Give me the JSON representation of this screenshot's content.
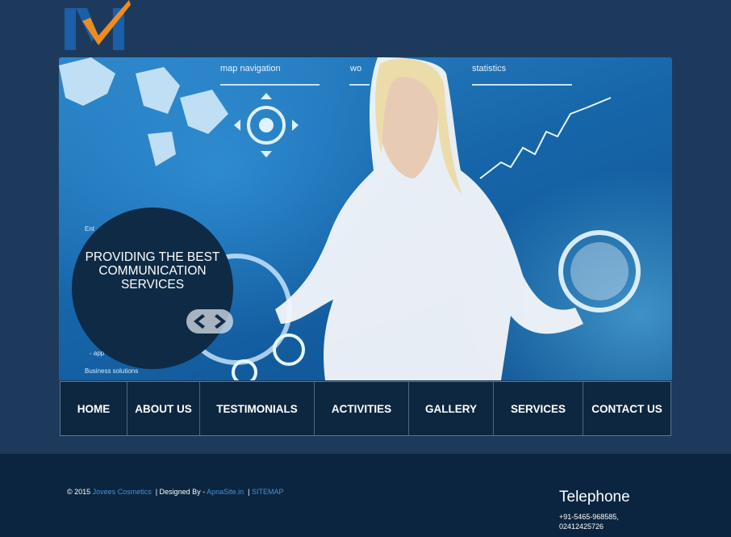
{
  "brand": {
    "logo_icon": "m-checkmark-logo-icon",
    "colors": {
      "blue": "#1a5fa8",
      "orange": "#f08c1e"
    }
  },
  "banner": {
    "hud_labels": {
      "map_navigation": "map navigation",
      "statistics": "statistics",
      "wo": "wo",
      "business": "Business solutions",
      "ent": "Ent",
      "app": "- app"
    },
    "caption": "PROVIDING THE BEST COMMUNICATION SERVICES",
    "prev_icon": "chevron-left-icon",
    "next_icon": "chevron-right-icon"
  },
  "nav": {
    "items": [
      {
        "label": "HOME"
      },
      {
        "label": "ABOUT US"
      },
      {
        "label": "TESTIMONIALS"
      },
      {
        "label": "ACTIVITIES"
      },
      {
        "label": "GALLERY"
      },
      {
        "label": "SERVICES"
      },
      {
        "label": "CONTACT US"
      }
    ]
  },
  "footer": {
    "copyright_prefix": "© 2015",
    "company_link": "Jovees Cosmetics",
    "designed_by": "| Designed By -",
    "designer_link": "ApnaSite.in",
    "separator": "|",
    "sitemap_link": "SITEMAP",
    "telephone_title": "Telephone",
    "phone_1": "+91-5465-968585,",
    "phone_2": "02412425726"
  }
}
